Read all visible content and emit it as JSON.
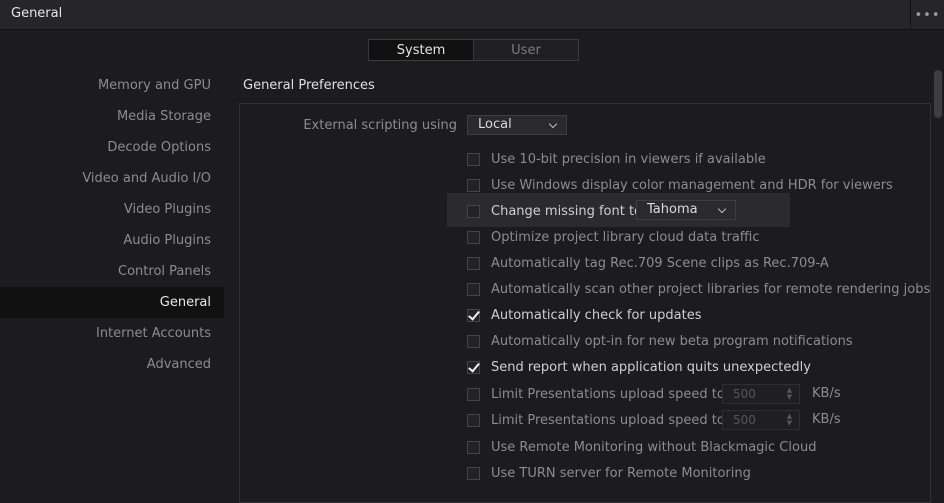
{
  "window": {
    "title": "General",
    "more_label": "•••"
  },
  "tabs": [
    {
      "label": "System",
      "active": true
    },
    {
      "label": "User",
      "active": false
    }
  ],
  "sidebar": {
    "items": [
      {
        "label": "Memory and GPU"
      },
      {
        "label": "Media Storage"
      },
      {
        "label": "Decode Options"
      },
      {
        "label": "Video and Audio I/O"
      },
      {
        "label": "Video Plugins"
      },
      {
        "label": "Audio Plugins"
      },
      {
        "label": "Control Panels"
      },
      {
        "label": "General",
        "active": true
      },
      {
        "label": "Internet Accounts"
      },
      {
        "label": "Advanced"
      }
    ]
  },
  "main": {
    "section_title": "General Preferences",
    "scripting": {
      "label": "External scripting using",
      "value": "Local"
    },
    "font_dropdown_value": "Tahoma",
    "options": [
      {
        "label": "Use 10-bit precision in viewers if available",
        "checked": false
      },
      {
        "label": "Use Windows display color management and HDR for viewers",
        "checked": false
      },
      {
        "label": "Change missing font to",
        "checked": false
      },
      {
        "label": "Optimize project library cloud data traffic",
        "checked": false
      },
      {
        "label": "Automatically tag Rec.709 Scene clips as Rec.709-A",
        "checked": false
      },
      {
        "label": "Automatically scan other project libraries for remote rendering jobs",
        "checked": false
      },
      {
        "label": "Automatically check for updates",
        "checked": true
      },
      {
        "label": "Automatically opt-in for new beta program notifications",
        "checked": false
      },
      {
        "label": "Send report when application quits unexpectedly",
        "checked": true
      },
      {
        "label": "Limit Presentations upload speed to",
        "checked": false,
        "value": "500",
        "unit": "KB/s"
      },
      {
        "label": "Limit Presentations upload speed to",
        "checked": false,
        "value": "500",
        "unit": "KB/s"
      },
      {
        "label": "Use Remote Monitoring without Blackmagic Cloud",
        "checked": false
      },
      {
        "label": "Use TURN server for Remote Monitoring",
        "checked": false
      }
    ]
  }
}
